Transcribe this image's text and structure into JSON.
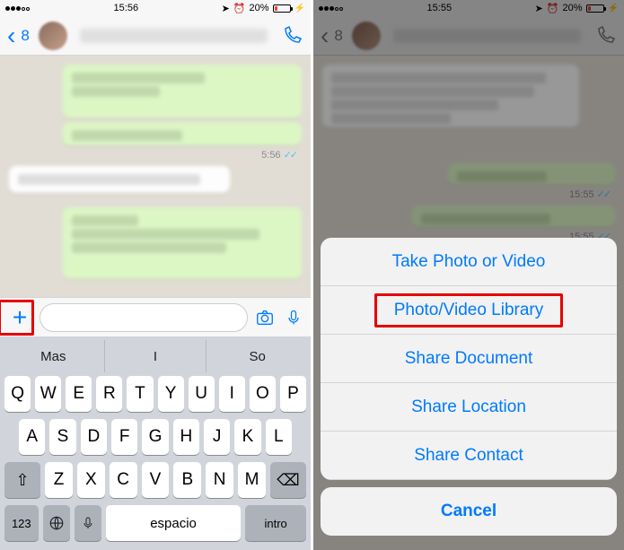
{
  "left": {
    "status": {
      "time": "15:56",
      "battery": "20%"
    },
    "header": {
      "back_count": "8"
    },
    "timestamps": {
      "t1": "5:56"
    },
    "suggestions": {
      "s1": "Mas",
      "s2": "I",
      "s3": "So"
    },
    "keyboard": {
      "row1": [
        "Q",
        "W",
        "E",
        "R",
        "T",
        "Y",
        "U",
        "I",
        "O",
        "P"
      ],
      "row2": [
        "A",
        "S",
        "D",
        "F",
        "G",
        "H",
        "J",
        "K",
        "L"
      ],
      "row3": [
        "Z",
        "X",
        "C",
        "V",
        "B",
        "N",
        "M"
      ],
      "shift": "⇧",
      "del": "⌫",
      "num": "123",
      "globe": "🌐",
      "mic": "🎤",
      "space": "espacio",
      "ret": "intro"
    }
  },
  "right": {
    "status": {
      "time": "15:55",
      "battery": "20%"
    },
    "header": {
      "back_count": "8"
    },
    "timestamps": {
      "t1": "15:55",
      "t2": "15:55"
    },
    "sheet": {
      "take": "Take Photo or Video",
      "library": "Photo/Video Library",
      "document": "Share Document",
      "location": "Share Location",
      "contact": "Share Contact",
      "cancel": "Cancel"
    }
  }
}
